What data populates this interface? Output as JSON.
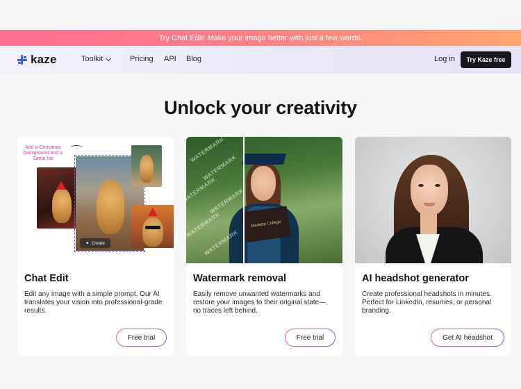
{
  "promo": {
    "text": "Try Chat Edit!  Make your image better with just a few words."
  },
  "nav": {
    "logo": "kaze",
    "toolkit": "Toolkit",
    "pricing": "Pricing",
    "api": "API",
    "blog": "Blog",
    "login": "Log in",
    "cta": "Try Kaze free"
  },
  "hero": {
    "title": "Unlock your creativity"
  },
  "cards": [
    {
      "title": "Chat Edit",
      "desc": "Edit any image with a simple prompt. Our AI translates your vision into professional-grade results.",
      "button": "Free trial",
      "note": "Add a Christmas background and a Santa hat",
      "create_label": "Create"
    },
    {
      "title": "Watermark removal",
      "desc": "Easily remove unwanted watermarks and restore your images to their original state— no traces left behind.",
      "button": "Free trial",
      "watermark": "WATERMARK",
      "diploma": "Marietta College"
    },
    {
      "title": "AI headshot generator",
      "desc": "Create professional headshots in minutes. Perfect for LinkedIn, resumes, or personal branding.",
      "button": "Get AI headshot"
    }
  ],
  "colors": {
    "accent": "#3a58e8",
    "promo_start": "#ff6f91",
    "promo_end": "#ffa56e",
    "cta_bg": "#17181c"
  }
}
